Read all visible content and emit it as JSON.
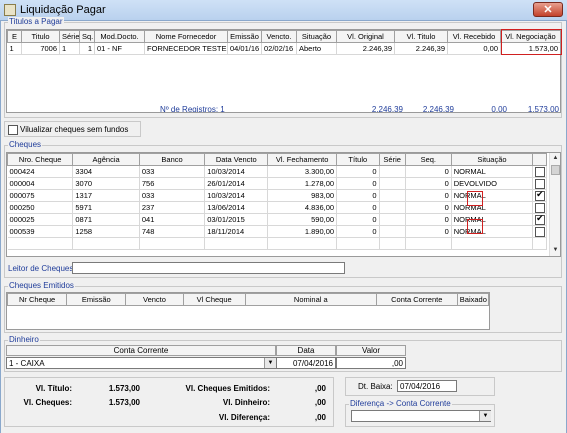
{
  "window": {
    "title": "Liquidação Pagar",
    "close_glyph": "✕"
  },
  "titulos": {
    "label": "Titulos a Pagar",
    "columns": [
      "E",
      "Titulo",
      "Série",
      "Sq.",
      "Mod.Docto.",
      "Nome Fornecedor",
      "Emissão",
      "Vencto.",
      "Situação",
      "Vl. Original",
      "Vl. Titulo",
      "Vl. Recebido",
      "Vl. Negociação"
    ],
    "rows": [
      [
        "1",
        "7006",
        "1",
        "1",
        "01 - NF",
        "FORNECEDOR TESTE",
        "04/01/16",
        "02/02/16",
        "Aberto",
        "2.246,39",
        "2.246,39",
        "0,00",
        "1.573,00"
      ]
    ],
    "footer": {
      "registros": "Nº de Registros: 1",
      "vl_original": "2.246,39",
      "vl_titulo": "2.246,39",
      "vl_recebido": "0,00",
      "vl_negociacao": "1.573,00"
    }
  },
  "visualizar_label": "Vilualizar cheques sem fundos",
  "cheques": {
    "label": "Cheques",
    "columns": [
      "Nro. Cheque",
      "Agência",
      "Banco",
      "Data Vencto",
      "Vl. Fechamento",
      "Título",
      "Série",
      "Seq.",
      "Situação",
      ""
    ],
    "rows": [
      {
        "nro": "000424",
        "ag": "3304",
        "banco": "033",
        "data": "10/03/2014",
        "vl": "3.300,00",
        "tit": "0",
        "serie": "",
        "seq": "0",
        "sit": "NORMAL",
        "checked": false
      },
      {
        "nro": "000004",
        "ag": "3070",
        "banco": "756",
        "data": "26/01/2014",
        "vl": "1.278,00",
        "tit": "0",
        "serie": "",
        "seq": "0",
        "sit": "DEVOLVIDO",
        "checked": false
      },
      {
        "nro": "000075",
        "ag": "1317",
        "banco": "033",
        "data": "10/03/2014",
        "vl": "983,00",
        "tit": "0",
        "serie": "",
        "seq": "0",
        "sit": "NORMAL",
        "checked": true
      },
      {
        "nro": "000250",
        "ag": "5971",
        "banco": "237",
        "data": "13/06/2014",
        "vl": "4.836,00",
        "tit": "0",
        "serie": "",
        "seq": "0",
        "sit": "NORMAL",
        "checked": false
      },
      {
        "nro": "000025",
        "ag": "0871",
        "banco": "041",
        "data": "03/01/2015",
        "vl": "590,00",
        "tit": "0",
        "serie": "",
        "seq": "0",
        "sit": "NORMAL",
        "checked": true
      },
      {
        "nro": "000539",
        "ag": "1258",
        "banco": "748",
        "data": "18/11/2014",
        "vl": "1.890,00",
        "tit": "0",
        "serie": "",
        "seq": "0",
        "sit": "NORMAL",
        "checked": false
      }
    ],
    "leitor_label": "Leitor de Cheques:",
    "leitor_value": ""
  },
  "emitidos": {
    "label": "Cheques Emitidos",
    "columns": [
      "Nr Cheque",
      "Emissão",
      "Vencto",
      "Vl Cheque",
      "Nominal a",
      "Conta Corrente",
      "Baixado"
    ]
  },
  "dinheiro": {
    "label": "Dinheiro",
    "col_conta": "Conta Corrente",
    "col_data": "Data",
    "col_valor": "Valor",
    "conta": "1 - CAIXA",
    "data": "07/04/2016",
    "valor": ",00"
  },
  "totais": {
    "vl_titulo_label": "Vl. Título:",
    "vl_titulo": "1.573,00",
    "vl_cheques_label": "Vl. Cheques:",
    "vl_cheques": "1.573,00",
    "vl_cheques_emitidos_label": "Vl. Cheques Emitidos:",
    "vl_cheques_emitidos": ",00",
    "vl_dinheiro_label": "Vl. Dinheiro:",
    "vl_dinheiro": ",00",
    "vl_diferenca_label": "Vl. Diferença:",
    "vl_diferenca": ",00"
  },
  "baixa": {
    "label": "Dt. Baixa:",
    "value": "07/04/2016"
  },
  "diferenca_conta": {
    "label": "Diferença -> Conta Corrente",
    "value": ""
  }
}
